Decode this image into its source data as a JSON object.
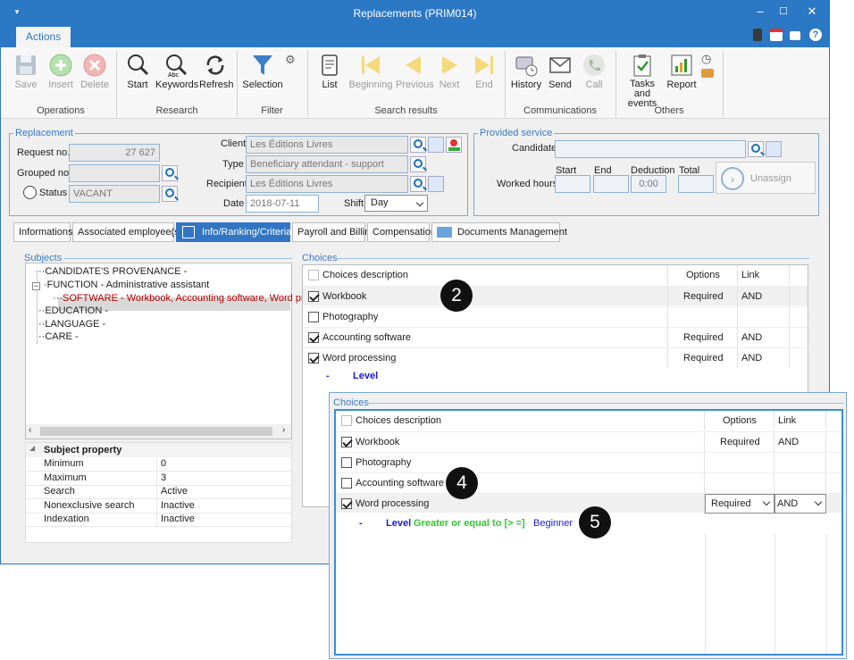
{
  "window": {
    "title": "Replacements (PRIM014)"
  },
  "ribbon": {
    "tab_actions": "Actions",
    "buttons": {
      "save": "Save",
      "insert": "Insert",
      "delete": "Delete",
      "start": "Start",
      "keywords": "Keywords",
      "refresh": "Refresh",
      "selection": "Selection",
      "list": "List",
      "beginning": "Beginning",
      "previous": "Previous",
      "next": "Next",
      "end": "End",
      "history": "History",
      "send": "Send",
      "call": "Call",
      "tasks_line1": "Tasks and",
      "tasks_line2": "events",
      "report": "Report"
    },
    "groups": {
      "operations": "Operations",
      "research": "Research",
      "filter": "Filter",
      "search_results": "Search results",
      "communications": "Communications",
      "others": "Others"
    }
  },
  "replacement": {
    "legend": "Replacement",
    "request_no_label": "Request no.",
    "request_no": "27 627",
    "grouped_no_label": "Grouped no.",
    "grouped_no": "",
    "status_label": "Status",
    "status": "VACANT",
    "client_label": "Client",
    "client": "Les Éditions Livres",
    "type_label": "Type",
    "type": "Beneficiary attendant - support",
    "recipient_label": "Recipient",
    "recipient": "Les Éditions Livres",
    "date_label": "Date",
    "date": "2018-07-11",
    "shift_label": "Shift",
    "shift": "Day"
  },
  "provided_service": {
    "legend": "Provided service",
    "candidate_label": "Candidate",
    "candidate": "",
    "worked_hours_label": "Worked hours",
    "start_label": "Start",
    "end_label": "End",
    "deduction_label": "Deduction",
    "total_label": "Total",
    "deduction": "0:00",
    "unassign": "Unassign"
  },
  "tabs": [
    "Informations",
    "Associated employee(s)",
    "Info/Ranking/Criteria",
    "Payroll and Billing",
    "Compensation",
    "Documents Management"
  ],
  "subjects": {
    "legend": "Subjects",
    "items": [
      "CANDIDATE'S PROVENANCE -",
      "FUNCTION - Administrative assistant",
      "SOFTWARE - Workbook, Accounting software, Word proce",
      "EDUCATION -",
      "LANGUAGE -",
      "CARE -"
    ]
  },
  "subject_property": {
    "header": "Subject property",
    "rows": [
      {
        "name": "Minimum",
        "value": "0"
      },
      {
        "name": "Maximum",
        "value": "3"
      },
      {
        "name": "Search",
        "value": "Active"
      },
      {
        "name": "Nonexclusive search",
        "value": "Inactive"
      },
      {
        "name": "Indexation",
        "value": "Inactive"
      }
    ]
  },
  "choices": {
    "legend": "Choices",
    "col_description": "Choices description",
    "col_options": "Options",
    "col_link": "Link",
    "rows": [
      {
        "label": "Workbook",
        "checked": true,
        "options": "Required",
        "link": "AND"
      },
      {
        "label": "Photography",
        "checked": false,
        "options": "",
        "link": ""
      },
      {
        "label": "Accounting software",
        "checked": true,
        "options": "Required",
        "link": "AND"
      },
      {
        "label": "Word processing",
        "checked": true,
        "options": "Required",
        "link": "AND"
      }
    ],
    "level_dash": "-",
    "level": "Level"
  },
  "choices_overlay": {
    "legend": "Choices",
    "col_description": "Choices description",
    "col_options": "Options",
    "col_link": "Link",
    "rows": [
      {
        "label": "Workbook",
        "checked": true,
        "options": "Required",
        "link": "AND"
      },
      {
        "label": "Photography",
        "checked": false,
        "options": "",
        "link": ""
      },
      {
        "label": "Accounting software",
        "checked": false,
        "options": "",
        "link": ""
      },
      {
        "label": "Word processing",
        "checked": true,
        "options": "Required",
        "link": "AND"
      }
    ],
    "level_dash": "-",
    "level": "Level",
    "level_condition": "Greater or equal to [> =]",
    "level_value": "Beginner"
  },
  "callouts": {
    "c2": "2",
    "c4": "4",
    "c5": "5"
  },
  "colors": {
    "accent": "#2b78c5",
    "level_blue": "#1a1ad6",
    "condition_green": "#2dc82d",
    "selected_red": "#b00000"
  }
}
